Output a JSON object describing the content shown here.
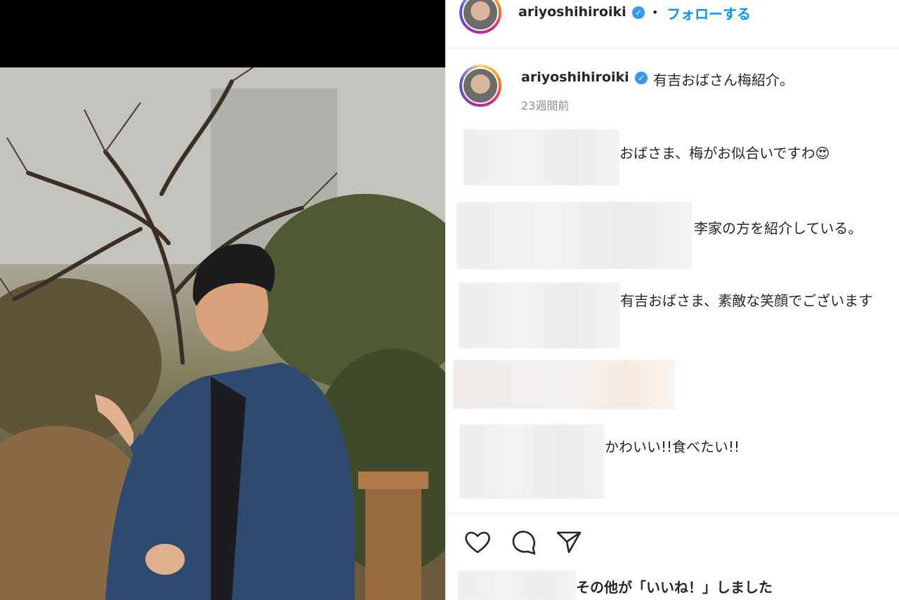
{
  "header": {
    "username": "ariyoshihiroiki",
    "separator": "•",
    "follow_label": "フォローする"
  },
  "caption": {
    "username": "ariyoshihiroiki",
    "text": "有吉おばさん梅紹介。",
    "time": "23週間前"
  },
  "comments": [
    {
      "text": "おばさま、梅がお似合いですわ😍"
    },
    {
      "text": "李家の方を紹介している。"
    },
    {
      "text": "有吉おばさま、素敵な笑顔でございます"
    },
    {
      "text": ""
    },
    {
      "text": "かわいい!!食べたい!!"
    }
  ],
  "actions": {
    "like_icon": "heart-icon",
    "comment_icon": "comment-icon",
    "share_icon": "share-icon"
  },
  "likes": {
    "text": "その他が「いいね！」しました"
  },
  "colors": {
    "follow": "#0095f6",
    "verified": "#3897f0"
  }
}
